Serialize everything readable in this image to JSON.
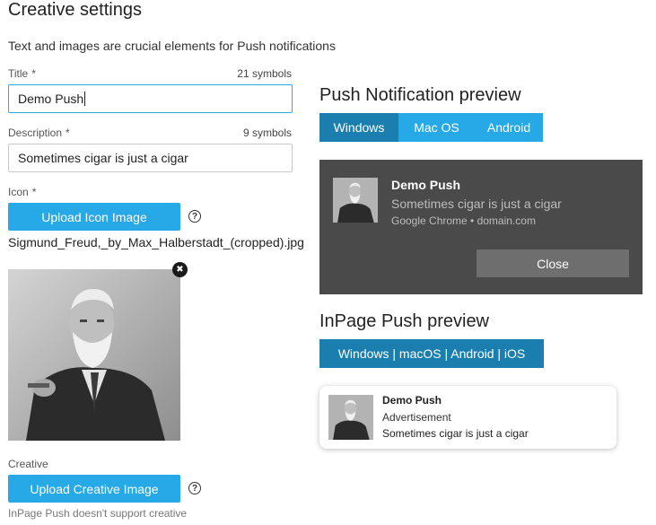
{
  "page": {
    "title": "Creative settings",
    "intro": "Text and images are crucial elements for Push notifications"
  },
  "form": {
    "title_label": "Title",
    "title_required": "*",
    "title_count": "21 symbols",
    "title_value": "Demo Push",
    "description_label": "Description",
    "description_required": "*",
    "description_count": "9 symbols",
    "description_value": "Sometimes cigar is just a cigar",
    "icon_label": "Icon",
    "icon_required": "*",
    "upload_icon_label": "Upload Icon Image",
    "icon_filename": "Sigmund_Freud,_by_Max_Halberstadt_(cropped).jpg",
    "remove_icon": "✖",
    "help_glyph": "?",
    "creative_label": "Creative",
    "upload_creative_label": "Upload Creative Image",
    "creative_note": "InPage Push doesn't support creative"
  },
  "push_preview": {
    "heading": "Push Notification preview",
    "tabs": [
      "Windows",
      "Mac OS",
      "Android"
    ],
    "active_tab": "Windows",
    "notif_title": "Demo Push",
    "notif_body": "Sometimes cigar is just a cigar",
    "notif_source": "Google Chrome • domain.com",
    "close_label": "Close"
  },
  "inpage_preview": {
    "heading": "InPage Push preview",
    "platforms": "Windows | macOS | Android | iOS",
    "title": "Demo Push",
    "tag": "Advertisement",
    "body": "Sometimes cigar is just a cigar"
  },
  "colors": {
    "accent": "#26a9e6",
    "accent_active": "#1a7faf",
    "windows_card": "#4a4a4a",
    "close_button": "#6e6e6e"
  }
}
